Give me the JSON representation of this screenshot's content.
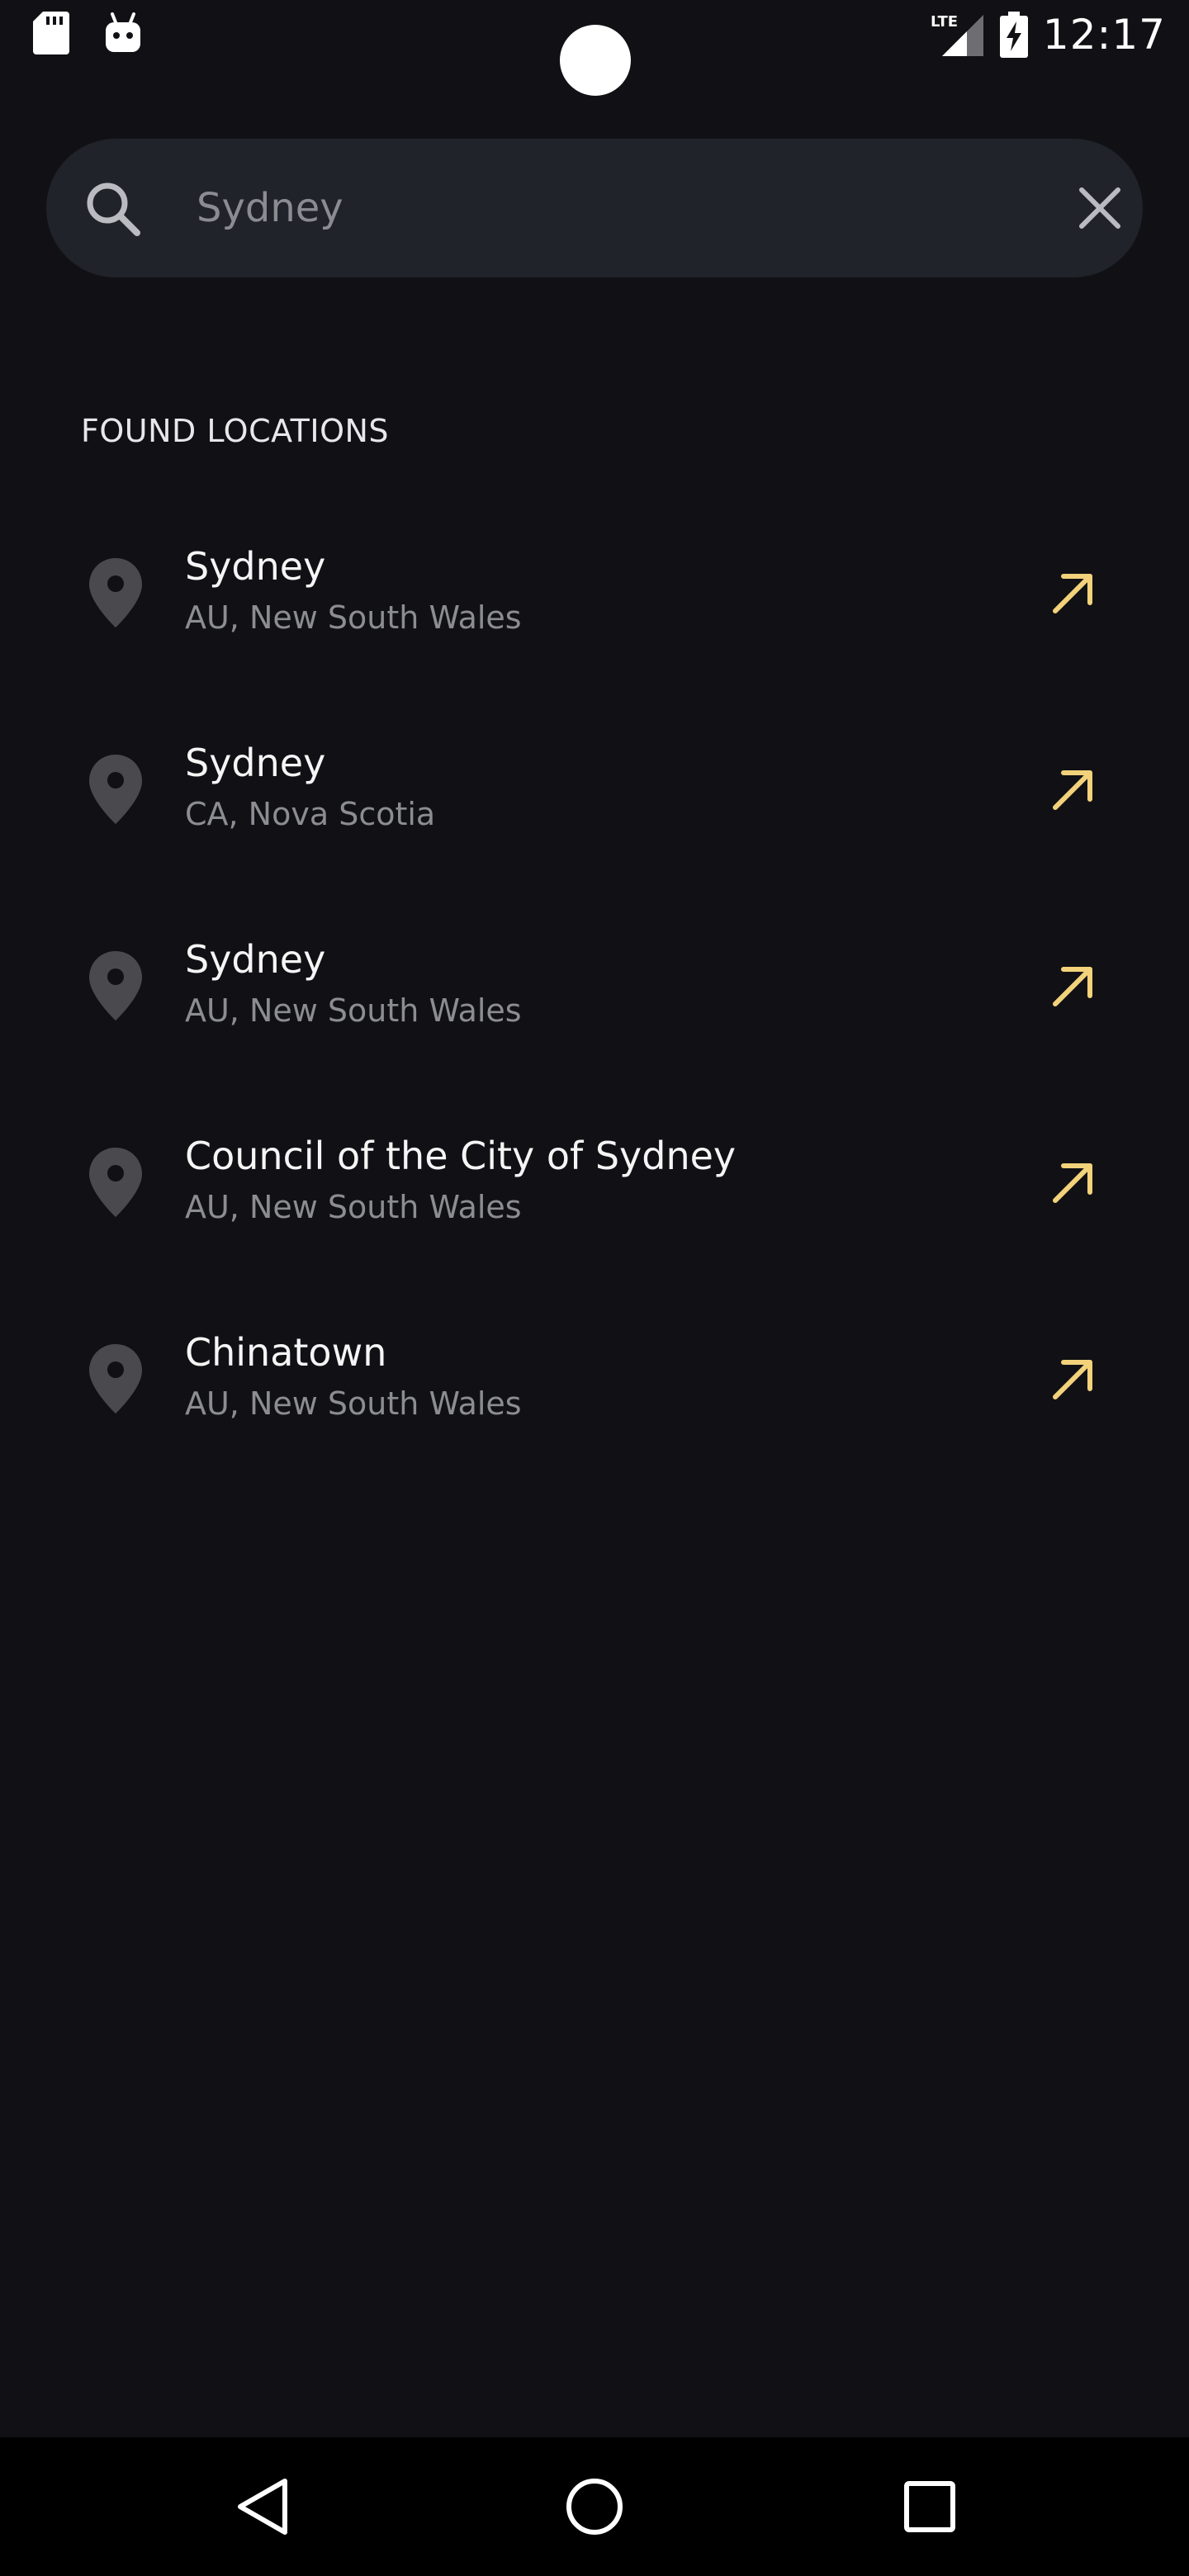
{
  "status_bar": {
    "time": "12:17",
    "network_label": "LTE",
    "left_icons": [
      "sd-card-icon",
      "android-debug-icon"
    ],
    "right_icons": [
      "signal-icon",
      "battery-charging-icon"
    ]
  },
  "search": {
    "query": "Sydney",
    "icons": {
      "leading": "search-icon",
      "trailing": "close-icon"
    }
  },
  "results": {
    "header": "FOUND LOCATIONS",
    "items": [
      {
        "name": "Sydney",
        "detail": "AU, New South Wales"
      },
      {
        "name": "Sydney",
        "detail": "CA, Nova Scotia"
      },
      {
        "name": "Sydney",
        "detail": "AU, New South Wales"
      },
      {
        "name": "Council of the City of Sydney",
        "detail": "AU, New South Wales"
      },
      {
        "name": "Chinatown",
        "detail": "AU, New South Wales"
      }
    ],
    "item_icon": "location-pin-icon",
    "action_icon": "arrow-up-right-icon"
  },
  "nav_bar": {
    "buttons": [
      "back-icon",
      "home-icon",
      "recents-icon"
    ]
  },
  "colors": {
    "background": "#111115",
    "search_bg": "#20232a",
    "accent": "#f2d27a",
    "pin": "#4a4a4e",
    "primary_text": "#f5f5f5",
    "secondary_text": "#8b8d93"
  }
}
